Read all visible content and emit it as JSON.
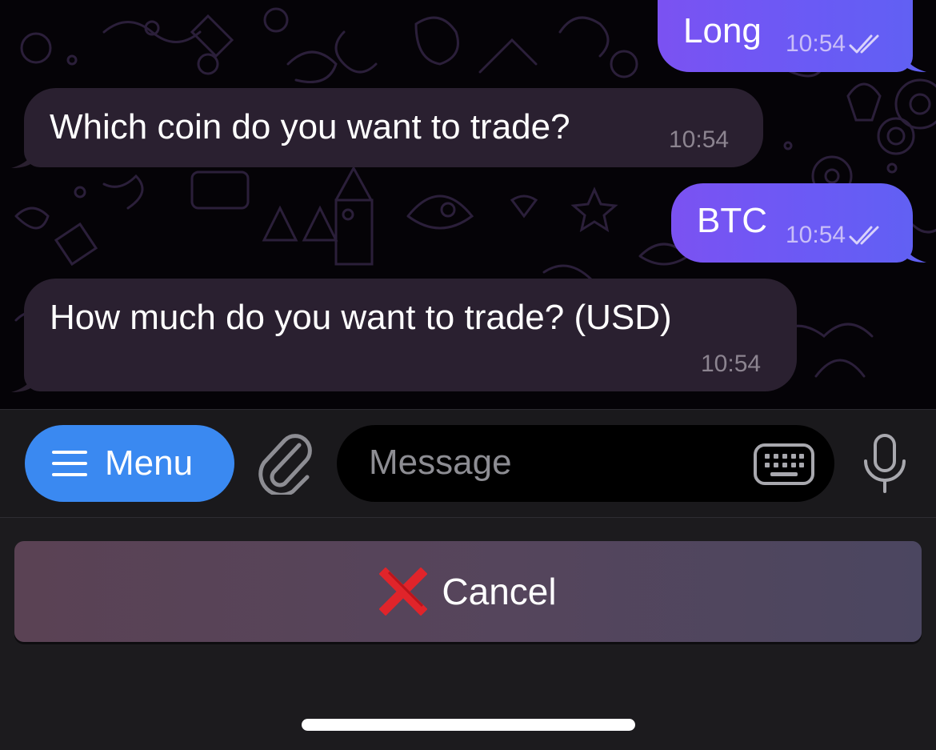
{
  "messages": [
    {
      "direction": "out",
      "text": "Long",
      "time": "10:54",
      "status": "read"
    },
    {
      "direction": "in",
      "text": "Which coin do you want to trade?",
      "time": "10:54"
    },
    {
      "direction": "out",
      "text": "BTC",
      "time": "10:54",
      "status": "read"
    },
    {
      "direction": "in",
      "text": "How much do you want to trade? (USD)",
      "time": "10:54"
    }
  ],
  "input_bar": {
    "menu_label": "Menu",
    "message_placeholder": "Message",
    "icons": [
      "menu-icon",
      "paperclip-icon",
      "keyboard-icon",
      "microphone-icon"
    ]
  },
  "reply_keyboard": {
    "cancel_emoji": "cross-mark-icon",
    "cancel_label": "Cancel"
  },
  "colors": {
    "outgoing_bubble": "#6d58f4",
    "incoming_bubble": "#2a2030",
    "menu_button": "#3a89f1",
    "cancel_cross": "#e0242a"
  }
}
